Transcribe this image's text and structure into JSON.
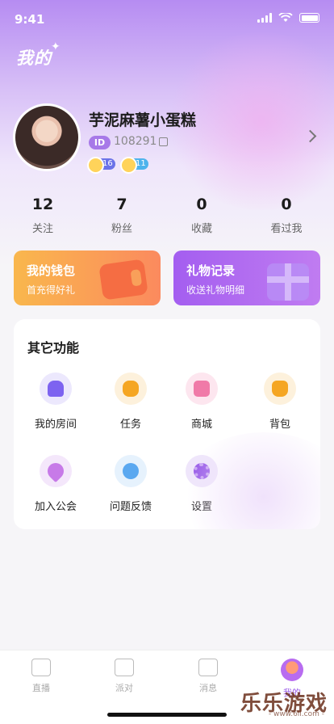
{
  "status": {
    "time": "9:41"
  },
  "header": {
    "title": "我的"
  },
  "profile": {
    "nickname": "芋泥麻薯小蛋糕",
    "id_label": "ID",
    "id_value": "108291",
    "levels": [
      "16",
      "11"
    ]
  },
  "stats": [
    {
      "value": "12",
      "label": "关注"
    },
    {
      "value": "7",
      "label": "粉丝"
    },
    {
      "value": "0",
      "label": "收藏"
    },
    {
      "value": "0",
      "label": "看过我"
    }
  ],
  "cards": {
    "wallet": {
      "title": "我的钱包",
      "subtitle": "首充得好礼"
    },
    "gift": {
      "title": "礼物记录",
      "subtitle": "收送礼物明细"
    }
  },
  "functions": {
    "title": "其它功能",
    "items": [
      {
        "label": "我的房间",
        "icon": "room-icon",
        "color": "#7d63f0"
      },
      {
        "label": "任务",
        "icon": "task-icon",
        "color": "#f5a623"
      },
      {
        "label": "商城",
        "icon": "shop-icon",
        "color": "#f07aa8"
      },
      {
        "label": "背包",
        "icon": "bag-icon",
        "color": "#f5a623"
      },
      {
        "label": "加入公会",
        "icon": "guild-icon",
        "color": "#c77ae8"
      },
      {
        "label": "问题反馈",
        "icon": "feedback-icon",
        "color": "#5aa8f0"
      },
      {
        "label": "设置",
        "icon": "settings-icon",
        "color": "#9a5ee8"
      }
    ]
  },
  "tabs": [
    {
      "label": "直播",
      "icon": "live-icon"
    },
    {
      "label": "派对",
      "icon": "party-icon"
    },
    {
      "label": "消息",
      "icon": "message-icon"
    },
    {
      "label": "我的",
      "icon": "me-icon"
    }
  ],
  "watermark": {
    "title": "乐乐游戏",
    "url": "- www.6ll.com -"
  }
}
